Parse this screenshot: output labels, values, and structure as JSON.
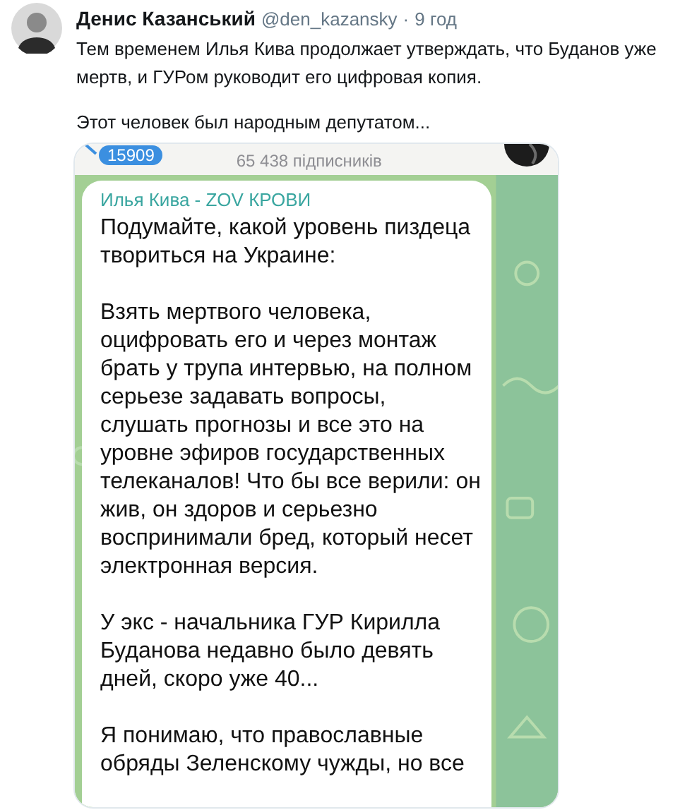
{
  "tweet": {
    "author": "Денис Казанський",
    "handle": "@den_kazansky",
    "separator": "·",
    "time": "9 год",
    "paragraphs": [
      "Тем временем Илья Кива продолжает утверждать, что Буданов уже мертв, и ГУРом руководит его цифровая копия.",
      "Этот человек был народным депутатом..."
    ]
  },
  "telegram": {
    "badge": "15909",
    "subscribers": "65 438 підписників",
    "message": {
      "sender": "Илья Кива - ZOV КРОВИ",
      "paragraphs": [
        [
          "Подумайте, какой уровень пиздеца",
          "твориться на Украине:"
        ],
        [
          "Взять мертвого человека,",
          "оцифровать его и через монтаж",
          "брать у трупа интервью, на полном",
          "серьезе задавать вопросы,",
          "слушать прогнозы и все это на",
          "уровне эфиров государственных",
          "телеканалов! Что бы все верили: он",
          "жив, он здоров и серьезно",
          "воспринимали бред, который несет",
          "электронная версия."
        ],
        [
          "У экс - начальника ГУР Кирилла",
          "Буданова недавно было девять",
          "дней, скоро уже 40..."
        ],
        [
          "Я понимаю, что православные",
          "обряды Зеленскому чужды, но все"
        ]
      ]
    }
  }
}
